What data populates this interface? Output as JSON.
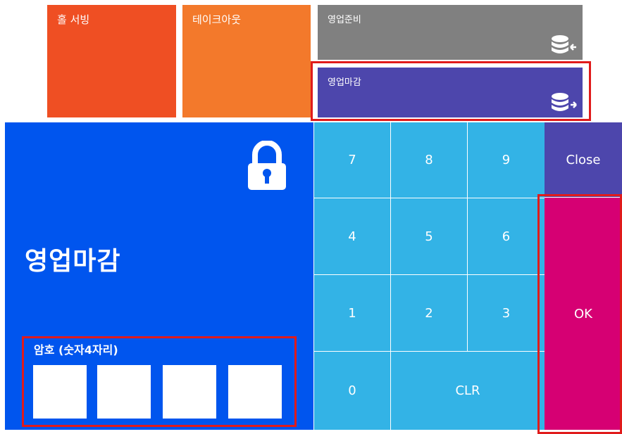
{
  "tiles": {
    "hall_serving": "홀 서빙",
    "takeout": "테이크아웃",
    "business_open": "영업준비",
    "business_close": "영업마감"
  },
  "dialog": {
    "title": "영업마감",
    "password_label": "암호 (숫자4자리)"
  },
  "keypad": {
    "keys": [
      "7",
      "8",
      "9",
      "4",
      "5",
      "6",
      "1",
      "2",
      "3",
      "0"
    ],
    "clear": "CLR",
    "close": "Close",
    "ok": "OK"
  },
  "colors": {
    "hall_serving": "#ef4f23",
    "takeout": "#f3792b",
    "business_open": "#808080",
    "business_close": "#4d46ac",
    "panel": "#0055ee",
    "key": "#33b3e6",
    "ok": "#d60073",
    "highlight": "#e01b1b"
  },
  "icons": {
    "business_open": "database-in-icon",
    "business_close": "database-out-icon",
    "lock": "lock-icon"
  }
}
